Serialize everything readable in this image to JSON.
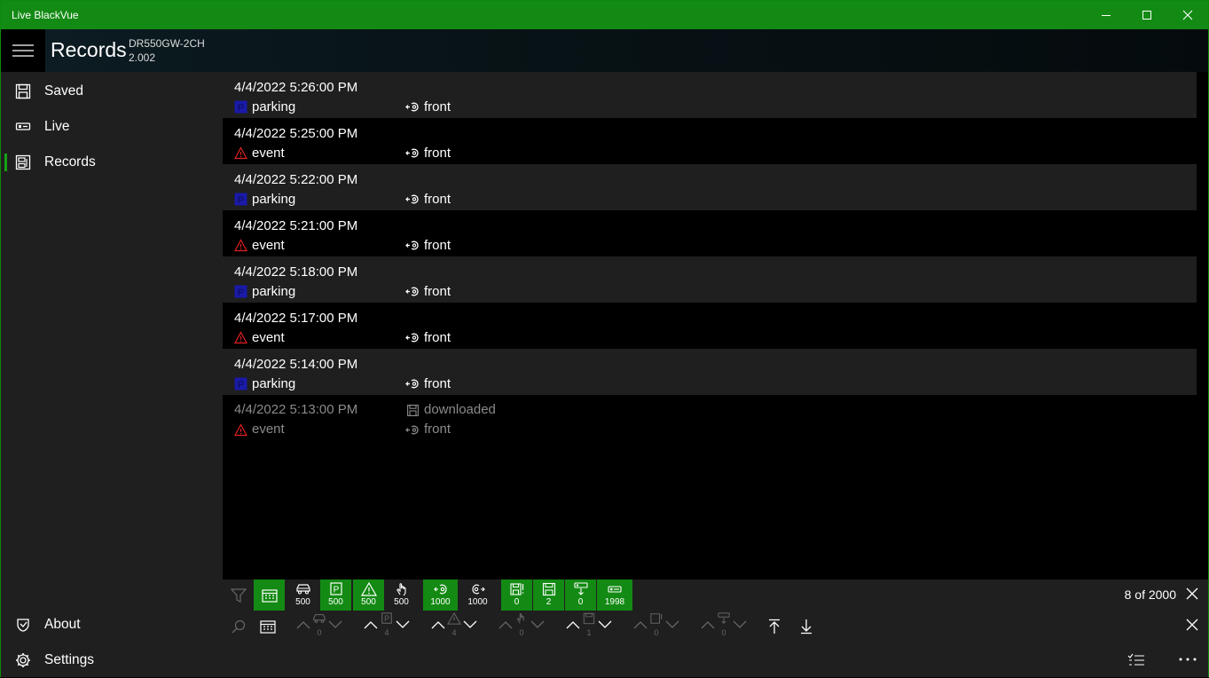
{
  "window": {
    "title": "Live BlackVue"
  },
  "header": {
    "title": "Records",
    "device_name": "DR550GW-2CH",
    "device_version": "2.002"
  },
  "sidebar": {
    "items": [
      {
        "label": "Saved",
        "icon": "floppy-icon"
      },
      {
        "label": "Live",
        "icon": "camera-icon"
      },
      {
        "label": "Records",
        "icon": "records-icon",
        "active": true
      }
    ],
    "footer": [
      {
        "label": "About",
        "icon": "about-icon"
      },
      {
        "label": "Settings",
        "icon": "gear-icon"
      }
    ]
  },
  "records": [
    {
      "time": "4/4/2022 5:26:00 PM",
      "type": "parking",
      "camera": "front"
    },
    {
      "time": "4/4/2022 5:25:00 PM",
      "type": "event",
      "camera": "front"
    },
    {
      "time": "4/4/2022 5:22:00 PM",
      "type": "parking",
      "camera": "front"
    },
    {
      "time": "4/4/2022 5:21:00 PM",
      "type": "event",
      "camera": "front"
    },
    {
      "time": "4/4/2022 5:18:00 PM",
      "type": "parking",
      "camera": "front"
    },
    {
      "time": "4/4/2022 5:17:00 PM",
      "type": "event",
      "camera": "front"
    },
    {
      "time": "4/4/2022 5:14:00 PM",
      "type": "parking",
      "camera": "front"
    },
    {
      "time": "4/4/2022 5:13:00 PM",
      "type": "event",
      "camera": "front",
      "status": "downloaded"
    }
  ],
  "filters": {
    "counts": {
      "normal": "500",
      "parking": "500",
      "event": "500",
      "manual": "500",
      "front": "1000",
      "rear": "1000",
      "unsaved": "0",
      "saved": "2",
      "downloading": "0",
      "live": "1998"
    },
    "summary": "8 of 2000"
  },
  "navigation": {
    "counts": {
      "normal": "0",
      "parking": "4",
      "event": "4",
      "manual": "0",
      "saved": "1",
      "unsaved": "0",
      "downloaded": "0"
    }
  },
  "colors": {
    "titlebar": "#138a13",
    "accent": "#16a016",
    "panel": "#1f1f1f",
    "event_icon": "#e02020",
    "parking_icon": "#1a1aa8"
  }
}
